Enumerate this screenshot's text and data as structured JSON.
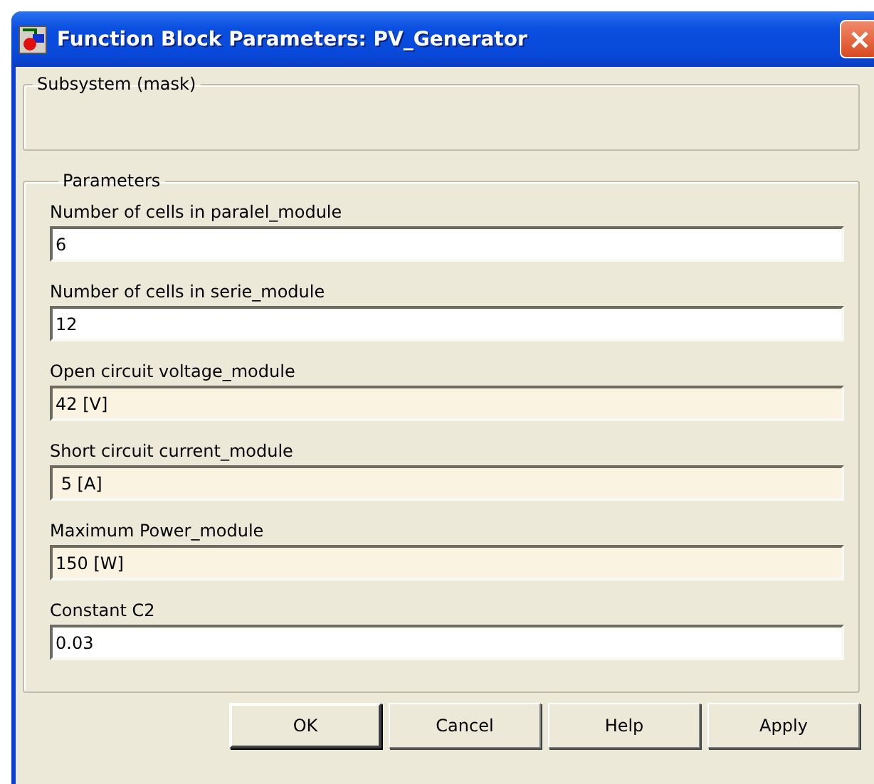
{
  "window": {
    "title": "Function Block Parameters: PV_Generator"
  },
  "description_group": {
    "title": "Subsystem (mask)"
  },
  "parameters_group": {
    "title": "Parameters",
    "fields": [
      {
        "label": "Number of cells in paralel_module",
        "value": "6",
        "kind": "plain"
      },
      {
        "label": "Number of cells in serie_module",
        "value": "12",
        "kind": "plain"
      },
      {
        "label": "Open circuit voltage_module",
        "value": "42 [V]",
        "kind": "tinted"
      },
      {
        "label": "Short circuit current_module",
        "value": " 5 [A]",
        "kind": "tinted"
      },
      {
        "label": "Maximum Power_module",
        "value": "150 [W]",
        "kind": "tinted"
      },
      {
        "label": "Constant C2",
        "value": "0.03",
        "kind": "plain"
      }
    ]
  },
  "buttons": [
    {
      "label": "OK",
      "default": true
    },
    {
      "label": "Cancel",
      "default": false
    },
    {
      "label": "Help",
      "default": false
    },
    {
      "label": "Apply",
      "default": false
    }
  ]
}
